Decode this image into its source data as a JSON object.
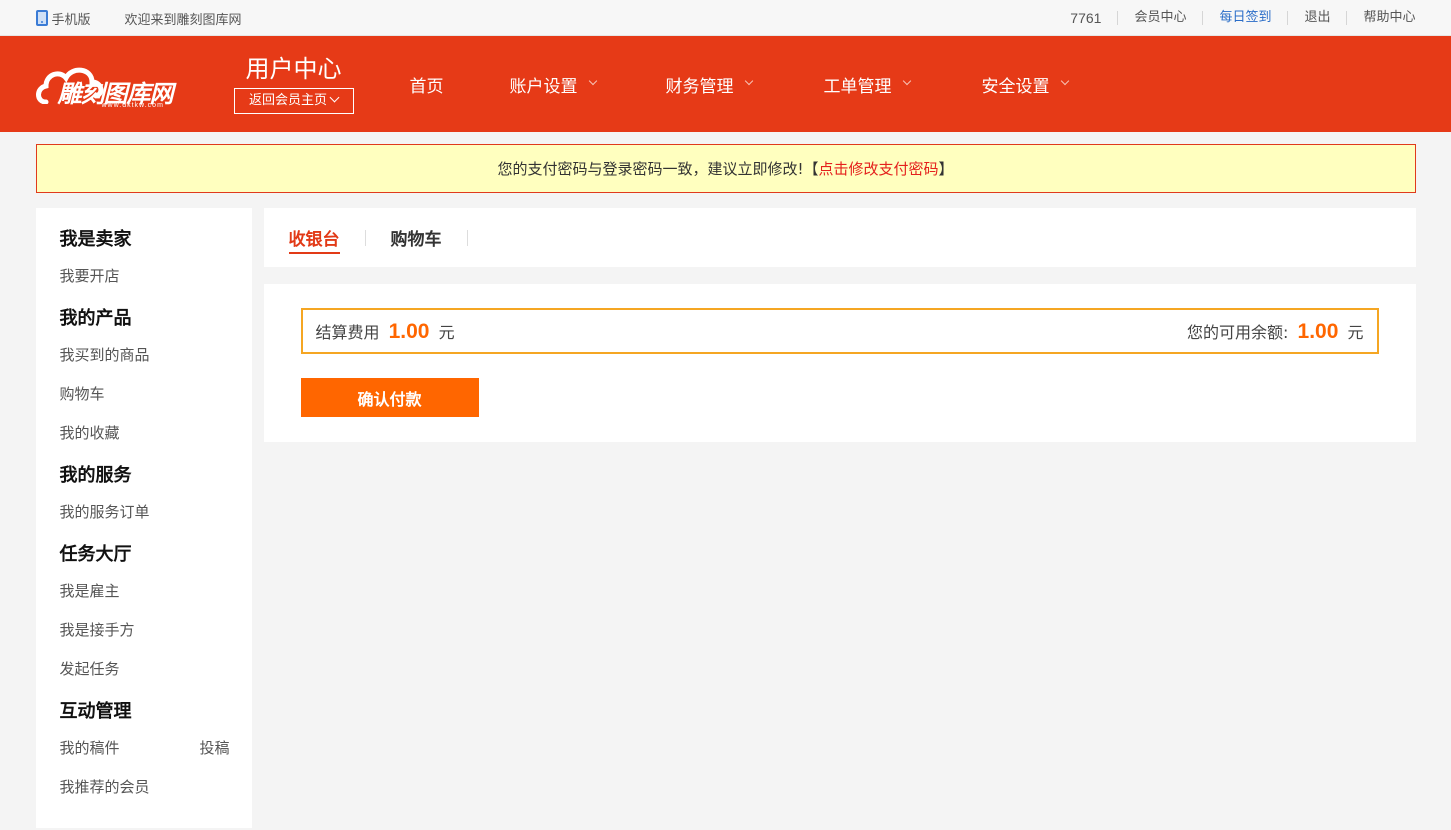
{
  "topbar": {
    "mobile_label": "手机版",
    "welcome": "欢迎来到雕刻图库网",
    "user_id": "7761",
    "links": [
      "会员中心",
      "每日签到",
      "退出",
      "帮助中心"
    ]
  },
  "header": {
    "logo_text": "雕刻图库网",
    "logo_sub": "www.dktkw.com",
    "title": "用户中心",
    "back_label": "返回会员主页",
    "nav": [
      "首页",
      "账户设置",
      "财务管理",
      "工单管理",
      "安全设置"
    ]
  },
  "notice": {
    "text": "您的支付密码与登录密码一致，建议立即修改!【",
    "link": "点击修改支付密码",
    "tail": "】"
  },
  "sidebar": {
    "groups": [
      {
        "title": "我是卖家",
        "items": [
          "我要开店"
        ]
      },
      {
        "title": "我的产品",
        "items": [
          "我买到的商品",
          "购物车",
          "我的收藏"
        ]
      },
      {
        "title": "我的服务",
        "items": [
          "我的服务订单"
        ]
      },
      {
        "title": "任务大厅",
        "items": [
          "我是雇主",
          "我是接手方",
          "发起任务"
        ]
      },
      {
        "title": "互动管理",
        "items": [
          "我的稿件",
          "我推荐的会员"
        ],
        "extra": "投稿"
      }
    ]
  },
  "tabs": [
    "收银台",
    "购物车"
  ],
  "payment": {
    "fee_label": "结算费用",
    "fee_amount": "1.00",
    "currency": "元",
    "balance_label": "您的可用余额:",
    "balance_amount": "1.00",
    "confirm_label": "确认付款"
  },
  "colors": {
    "header_bg": "#e63a17",
    "accent_orange": "#ff6600",
    "notice_bg": "#ffffbf",
    "link_blue": "#2a6dc8"
  }
}
